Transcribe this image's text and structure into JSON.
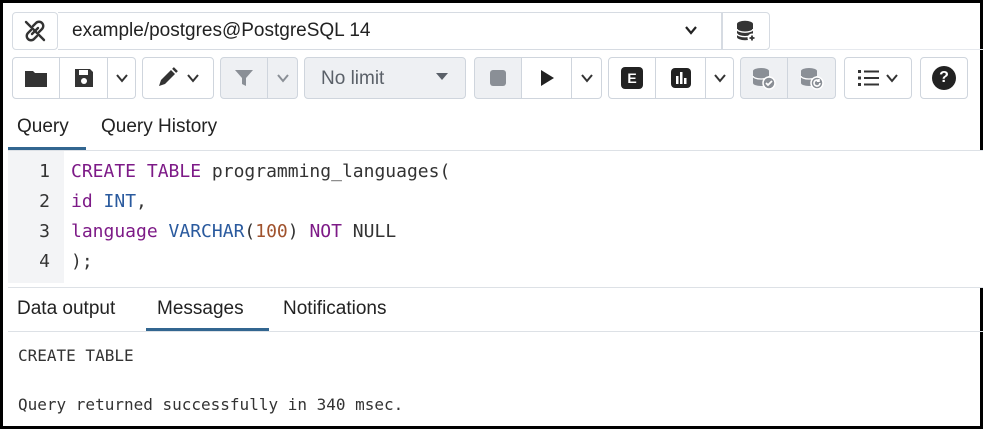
{
  "connection": {
    "name": "example/postgres@PostgreSQL 14",
    "icons": {
      "connect": "link-icon",
      "database": "database-icon",
      "dropdown": "chevron-down-icon"
    }
  },
  "toolbar": {
    "limit_label": "No limit",
    "icons": [
      "folder-icon",
      "save-icon",
      "chevron-down-icon",
      "edit-pen-icon",
      "chevron-down-icon",
      "filter-icon",
      "chevron-down-icon",
      "stop-icon",
      "play-icon",
      "chevron-down-icon",
      "explain-icon",
      "explain-analyze-icon",
      "chevron-down-icon",
      "commit-icon",
      "rollback-icon",
      "macros-icon",
      "help-icon"
    ],
    "explain_glyph": "E",
    "help_glyph": "?"
  },
  "editor_tabs": [
    {
      "label": "Query",
      "active": true
    },
    {
      "label": "Query History",
      "active": false
    }
  ],
  "editor": {
    "lines": [
      {
        "number": "1",
        "tokens": [
          {
            "t": "CREATE",
            "c": "kw"
          },
          {
            "t": " "
          },
          {
            "t": "TABLE",
            "c": "kw"
          },
          {
            "t": " programming_languages("
          }
        ]
      },
      {
        "number": "2",
        "tokens": [
          {
            "t": "id",
            "c": "kw"
          },
          {
            "t": " "
          },
          {
            "t": "INT",
            "c": "ty"
          },
          {
            "t": ","
          }
        ]
      },
      {
        "number": "3",
        "tokens": [
          {
            "t": "language",
            "c": "kw"
          },
          {
            "t": " "
          },
          {
            "t": "VARCHAR",
            "c": "ty"
          },
          {
            "t": "("
          },
          {
            "t": "100",
            "c": "nm"
          },
          {
            "t": ") "
          },
          {
            "t": "NOT",
            "c": "kw"
          },
          {
            "t": " NULL"
          }
        ]
      },
      {
        "number": "4",
        "tokens": [
          {
            "t": ");"
          }
        ]
      }
    ]
  },
  "output_tabs": [
    {
      "label": "Data output",
      "active": false
    },
    {
      "label": "Messages",
      "active": true
    },
    {
      "label": "Notifications",
      "active": false
    }
  ],
  "messages": {
    "line1": "CREATE TABLE",
    "line2": "Query returned successfully in 340 msec."
  },
  "colors": {
    "accent": "#326690",
    "keyword": "#7d1a87",
    "type": "#2a5a9e",
    "number": "#a0522d"
  }
}
